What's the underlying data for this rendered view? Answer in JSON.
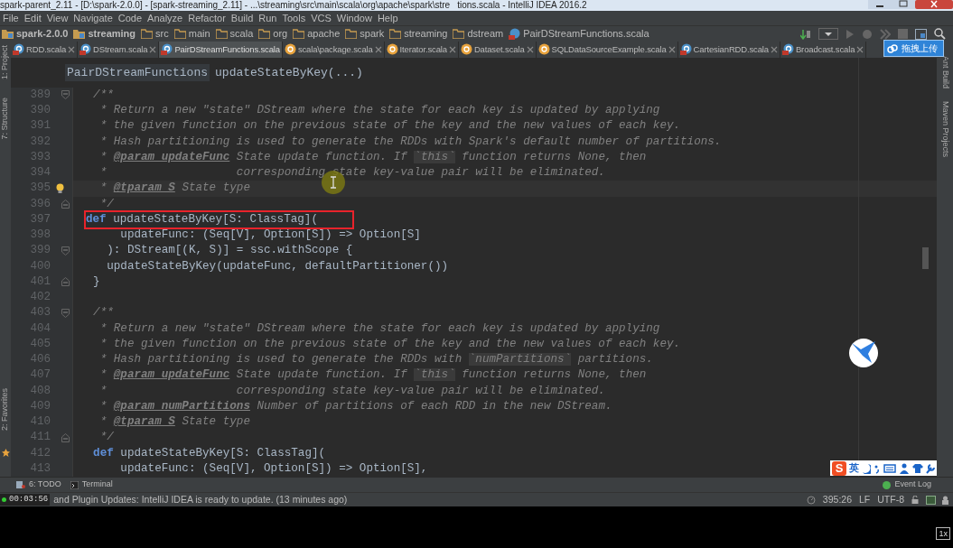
{
  "window": {
    "title_left": "spark-parent_2.11 - [D:\\spark-2.0.0] - [spark-streaming_2.11] - ...\\streaming\\src\\main\\scala\\org\\apache\\spark\\stre",
    "title_right": "tions.scala - IntelliJ IDEA 2016.2"
  },
  "menu": [
    "File",
    "Edit",
    "View",
    "Navigate",
    "Code",
    "Analyze",
    "Refactor",
    "Build",
    "Run",
    "Tools",
    "VCS",
    "Window",
    "Help"
  ],
  "breadcrumb": [
    {
      "kind": "module",
      "label": "spark-2.0.0"
    },
    {
      "kind": "module",
      "label": "streaming"
    },
    {
      "kind": "folder",
      "label": "src"
    },
    {
      "kind": "folder",
      "label": "main"
    },
    {
      "kind": "folder",
      "label": "scala"
    },
    {
      "kind": "folder",
      "label": "org"
    },
    {
      "kind": "folder",
      "label": "apache"
    },
    {
      "kind": "folder",
      "label": "spark"
    },
    {
      "kind": "folder",
      "label": "streaming"
    },
    {
      "kind": "folder",
      "label": "dstream"
    },
    {
      "kind": "file",
      "label": "PairDStreamFunctions.scala"
    }
  ],
  "upload_tooltip": "拖拽上传",
  "left_tools": [
    "1: Project",
    "7: Structure"
  ],
  "left_bottom_tool": "2: Favorites",
  "right_tools": [
    "Ant Build",
    "Maven Projects"
  ],
  "tabs": [
    {
      "kind": "class",
      "label": "RDD.scala",
      "selected": false
    },
    {
      "kind": "class",
      "label": "DStream.scala",
      "selected": false
    },
    {
      "kind": "class",
      "label": "PairDStreamFunctions.scala",
      "selected": true
    },
    {
      "kind": "object",
      "label": "scala\\package.scala",
      "selected": false
    },
    {
      "kind": "object",
      "label": "Iterator.scala",
      "selected": false
    },
    {
      "kind": "object",
      "label": "Dataset.scala",
      "selected": false
    },
    {
      "kind": "object",
      "label": "SQLDataSourceExample.scala",
      "selected": false
    },
    {
      "kind": "class",
      "label": "CartesianRDD.scala",
      "selected": false
    },
    {
      "kind": "class",
      "label": "Broadcast.scala",
      "selected": false
    }
  ],
  "editor_header": {
    "class_name": "PairDStreamFunctions",
    "method": "updateStateByKey(...)"
  },
  "lines": [
    {
      "number": "389",
      "fold_start": true,
      "fold_end": false,
      "current": false,
      "boxed": false,
      "tokens": [
        {
          "kind": "doc",
          "text": "  /**"
        }
      ]
    },
    {
      "number": "390",
      "fold_start": false,
      "fold_end": false,
      "current": false,
      "boxed": false,
      "tokens": [
        {
          "kind": "doc",
          "text": "   * Return a new \"state\" DStream where the state for each key is updated by applying"
        }
      ]
    },
    {
      "number": "391",
      "fold_start": false,
      "fold_end": false,
      "current": false,
      "boxed": false,
      "tokens": [
        {
          "kind": "doc",
          "text": "   * the given function on the previous state of the key and the new values of each key."
        }
      ]
    },
    {
      "number": "392",
      "fold_start": false,
      "fold_end": false,
      "current": false,
      "boxed": false,
      "tokens": [
        {
          "kind": "doc",
          "text": "   * Hash partitioning is used to generate the RDDs with Spark's default number of partitions."
        }
      ]
    },
    {
      "number": "393",
      "fold_start": false,
      "fold_end": false,
      "current": false,
      "boxed": false,
      "tokens": [
        {
          "kind": "doc",
          "text": "   * "
        },
        {
          "kind": "tag",
          "text": "@param updateFunc"
        },
        {
          "kind": "doc",
          "text": " State update function. If "
        },
        {
          "kind": "code",
          "text": "`this`"
        },
        {
          "kind": "doc",
          "text": " function returns None, then"
        }
      ]
    },
    {
      "number": "394",
      "fold_start": false,
      "fold_end": false,
      "current": false,
      "boxed": false,
      "tokens": [
        {
          "kind": "doc",
          "text": "   *                   corresponding state key-value pair will be eliminated."
        }
      ]
    },
    {
      "number": "395",
      "fold_start": false,
      "fold_end": false,
      "current": true,
      "boxed": false,
      "tokens": [
        {
          "kind": "doc",
          "text": "   * "
        },
        {
          "kind": "tag",
          "text": "@tparam S"
        },
        {
          "kind": "doc",
          "text": " State type"
        }
      ]
    },
    {
      "number": "396",
      "fold_start": false,
      "fold_end": true,
      "current": false,
      "boxed": false,
      "tokens": [
        {
          "kind": "doc",
          "text": "   */"
        }
      ]
    },
    {
      "number": "397",
      "fold_start": false,
      "fold_end": false,
      "current": false,
      "boxed": true,
      "tokens": [
        {
          "kind": "keyword",
          "text": "def"
        },
        {
          "kind": "plain",
          "text": " updateStateByKey[S: ClassTag]("
        }
      ]
    },
    {
      "number": "398",
      "fold_start": false,
      "fold_end": false,
      "current": false,
      "boxed": false,
      "tokens": [
        {
          "kind": "plain",
          "text": "      updateFunc: (Seq[V], Option[S]) => Option[S]"
        }
      ]
    },
    {
      "number": "399",
      "fold_start": true,
      "fold_end": false,
      "current": false,
      "boxed": false,
      "tokens": [
        {
          "kind": "plain",
          "text": "    ): DStream[(K, S)] = ssc.withScope {"
        }
      ]
    },
    {
      "number": "400",
      "fold_start": false,
      "fold_end": false,
      "current": false,
      "boxed": false,
      "tokens": [
        {
          "kind": "plain",
          "text": "    updateStateByKey(updateFunc, defaultPartitioner())"
        }
      ]
    },
    {
      "number": "401",
      "fold_start": false,
      "fold_end": true,
      "current": false,
      "boxed": false,
      "tokens": [
        {
          "kind": "plain",
          "text": "  }"
        }
      ]
    },
    {
      "number": "402",
      "fold_start": false,
      "fold_end": false,
      "current": false,
      "boxed": false
    },
    {
      "number": "403",
      "fold_start": true,
      "fold_end": false,
      "current": false,
      "boxed": false,
      "tokens": [
        {
          "kind": "doc",
          "text": "  /**"
        }
      ]
    },
    {
      "number": "404",
      "fold_start": false,
      "fold_end": false,
      "current": false,
      "boxed": false,
      "tokens": [
        {
          "kind": "doc",
          "text": "   * Return a new \"state\" DStream where the state for each key is updated by applying"
        }
      ]
    },
    {
      "number": "405",
      "fold_start": false,
      "fold_end": false,
      "current": false,
      "boxed": false,
      "tokens": [
        {
          "kind": "doc",
          "text": "   * the given function on the previous state of the key and the new values of each key."
        }
      ]
    },
    {
      "number": "406",
      "fold_start": false,
      "fold_end": false,
      "current": false,
      "boxed": false,
      "tokens": [
        {
          "kind": "doc",
          "text": "   * Hash partitioning is used to generate the RDDs with "
        },
        {
          "kind": "code",
          "text": "`numPartitions`"
        },
        {
          "kind": "doc",
          "text": " partitions."
        }
      ]
    },
    {
      "number": "407",
      "fold_start": false,
      "fold_end": false,
      "current": false,
      "boxed": false,
      "tokens": [
        {
          "kind": "doc",
          "text": "   * "
        },
        {
          "kind": "tag",
          "text": "@param updateFunc"
        },
        {
          "kind": "doc",
          "text": " State update function. If "
        },
        {
          "kind": "code",
          "text": "`this`"
        },
        {
          "kind": "doc",
          "text": " function returns None, then"
        }
      ]
    },
    {
      "number": "408",
      "fold_start": false,
      "fold_end": false,
      "current": false,
      "boxed": false,
      "tokens": [
        {
          "kind": "doc",
          "text": "   *                   corresponding state key-value pair will be eliminated."
        }
      ]
    },
    {
      "number": "409",
      "fold_start": false,
      "fold_end": false,
      "current": false,
      "boxed": false,
      "tokens": [
        {
          "kind": "doc",
          "text": "   * "
        },
        {
          "kind": "tag",
          "text": "@param numPartitions"
        },
        {
          "kind": "doc",
          "text": " Number of partitions of each RDD in the new DStream."
        }
      ]
    },
    {
      "number": "410",
      "fold_start": false,
      "fold_end": false,
      "current": false,
      "boxed": false,
      "tokens": [
        {
          "kind": "doc",
          "text": "   * "
        },
        {
          "kind": "tag",
          "text": "@tparam S"
        },
        {
          "kind": "doc",
          "text": " State type"
        }
      ]
    },
    {
      "number": "411",
      "fold_start": false,
      "fold_end": true,
      "current": false,
      "boxed": false,
      "tokens": [
        {
          "kind": "doc",
          "text": "   */"
        }
      ]
    },
    {
      "number": "412",
      "fold_start": false,
      "fold_end": false,
      "current": false,
      "boxed": false,
      "tokens": [
        {
          "kind": "keyword",
          "text": "  def"
        },
        {
          "kind": "plain",
          "text": " updateStateByKey[S: ClassTag]("
        }
      ]
    },
    {
      "number": "413",
      "fold_start": false,
      "fold_end": false,
      "current": false,
      "boxed": false,
      "tokens": [
        {
          "kind": "plain",
          "text": "      updateFunc: (Seq[V], Option[S]) => Option[S],"
        }
      ]
    }
  ],
  "ime_bar": {
    "logo": "S",
    "mode": "英"
  },
  "tool_buttons": [
    "6: TODO",
    "Terminal"
  ],
  "event_log": "Event Log",
  "recording_timer": "00:03:56",
  "status_message": "and Plugin Updates: IntelliJ IDEA is ready to update. (13 minutes ago)",
  "status_items": [
    "395:26",
    "LF",
    "UTF-8"
  ],
  "player_speed": "1x"
}
